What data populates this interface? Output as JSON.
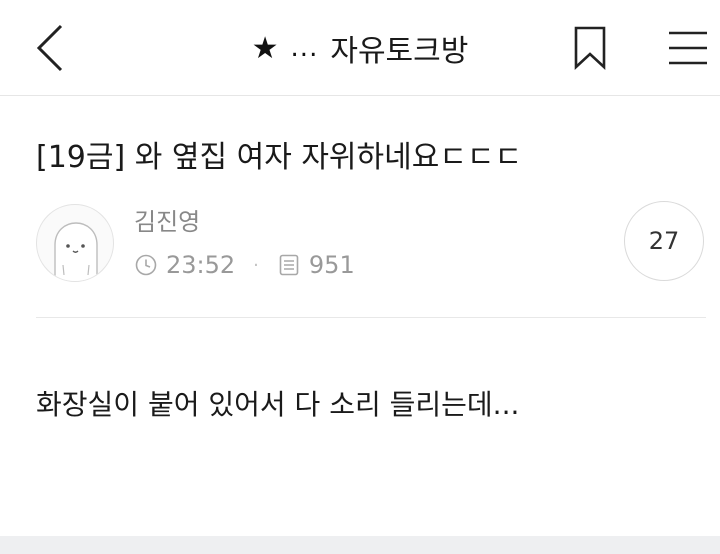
{
  "topbar": {
    "title_prefix_icon": "star-icon",
    "title_ellipsis": "...",
    "title": "자유토크방"
  },
  "post": {
    "title": "[19금] 와 옆집 여자 자위하네요ㄷㄷㄷ",
    "author": "김진영",
    "time": "23:52",
    "views": "951",
    "comment_count": "27",
    "body": "화장실이 붙어 있어서 다 소리 들리는데..."
  },
  "icons": {
    "back": "chevron-left-icon",
    "bookmark": "bookmark-icon",
    "menu": "hamburger-menu-icon",
    "time": "clock-icon",
    "views": "document-icon",
    "avatar": "default-avatar-icon"
  },
  "colors": {
    "text": "#1a1a1a",
    "muted": "#999999",
    "divider": "#e8e8e8"
  }
}
